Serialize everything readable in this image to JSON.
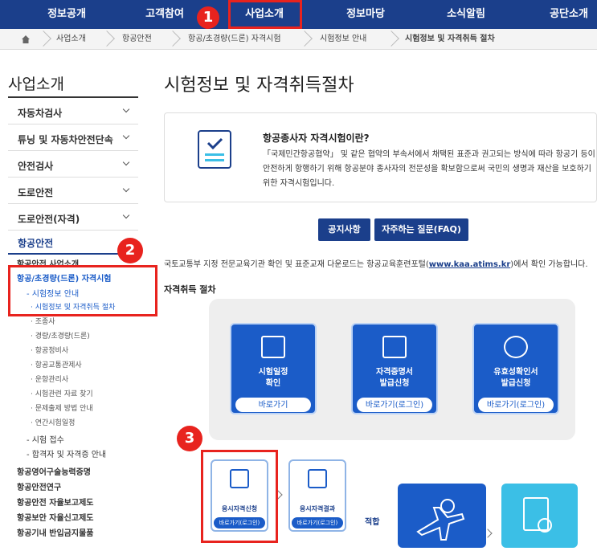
{
  "topnav": {
    "items": [
      "정보공개",
      "고객참여",
      "사업소개",
      "정보마당",
      "소식알림",
      "공단소개"
    ]
  },
  "breadcrumb": {
    "items": [
      "사업소개",
      "항공안전",
      "항공/초경량(드론) 자격시험",
      "시험정보 안내",
      "시험정보 및 자격취득 절차"
    ]
  },
  "sidebar": {
    "title": "사업소개",
    "menus": [
      "자동차검사",
      "튜닝 및 자동차안전단속",
      "안전검사",
      "도로안전",
      "도로안전(자격)",
      "항공안전"
    ],
    "sub": {
      "air_business": "항공안전 사업소개",
      "drone_exam": "항공/초경량(드론) 자격시험",
      "exam_info": "- 시험정보 안내",
      "exam_info_children": [
        "· 시험정보 및 자격취득 절차",
        "· 조종사",
        "· 경량/초경량(드론)",
        "· 항공정비사",
        "· 항공교통관제사",
        "· 운항관리사",
        "· 시험관련 자료 찾기",
        "· 문제출제 방법 안내",
        "· 연간시험일정"
      ],
      "exam_apply": "- 시험 접수",
      "pass_info": "- 합격자 및 자격증 안내",
      "more": [
        "항공영어구술능력증명",
        "항공안전연구",
        "항공안전 자율보고제도",
        "항공보안 자율신고제도",
        "항공기내 반입금지물품"
      ]
    }
  },
  "main": {
    "title": "시험정보 및 자격취득절차",
    "info_title": "항공종사자 자격시험이란?",
    "info_lines": [
      "「국제민간항공협약」 및 같은 협약의 부속서에서 채택된 표준과 권고되는 방식에 따라 항공기 등이",
      "안전하게 항행하기 위해 항공분야 종사자의 전문성을 확보함으로써 국민의 생명과 재산을 보호하기",
      "위한 자격시험입니다."
    ],
    "btn_notice": "공지사항",
    "btn_faq": "자주하는 질문(FAQ)",
    "notice_prefix": "국토교통부 지정 전문교육기관 확인 및 표준교재 다운로드는 항공교육훈련포털(",
    "notice_link": "www.kaa.atims.kr",
    "notice_suffix": ")에서 확인 가능합니다.",
    "section_title": "자격취득 절차",
    "cards": [
      {
        "l1": "시험일정",
        "l2": "확인",
        "go": "바로가기"
      },
      {
        "l1": "자격증명서",
        "l2": "발급신청",
        "go": "바로가기(로그인)"
      },
      {
        "l1": "유효성확인서",
        "l2": "발급신청",
        "go": "바로가기(로그인)"
      }
    ],
    "steps": [
      {
        "label": "응시자격신청",
        "go": "바로가기(로그인)"
      },
      {
        "label": "응시자격결과",
        "go": "바로가기(로그인)"
      }
    ],
    "pass_label": "적합"
  },
  "annotations": [
    "1",
    "2",
    "3"
  ],
  "colors": {
    "navy": "#1b3f8b",
    "blue": "#1b5cc8",
    "red": "#e8231e",
    "cyan": "#3bbfe6"
  }
}
